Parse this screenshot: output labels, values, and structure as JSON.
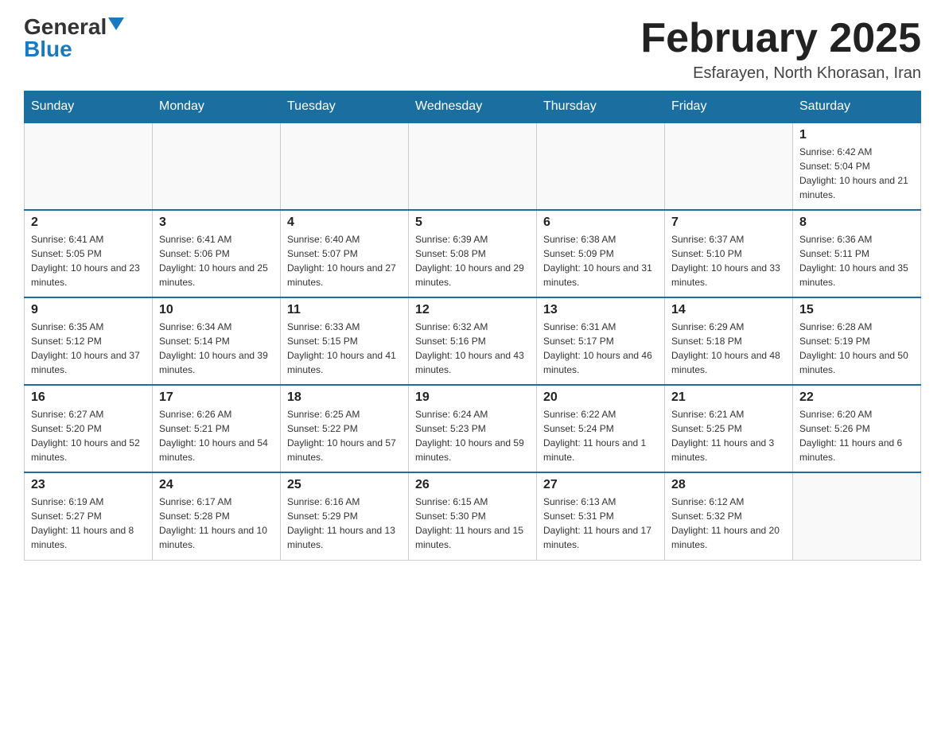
{
  "logo": {
    "general": "General",
    "blue": "Blue"
  },
  "title": "February 2025",
  "location": "Esfarayen, North Khorasan, Iran",
  "days_of_week": [
    "Sunday",
    "Monday",
    "Tuesday",
    "Wednesday",
    "Thursday",
    "Friday",
    "Saturday"
  ],
  "weeks": [
    [
      {
        "day": "",
        "info": ""
      },
      {
        "day": "",
        "info": ""
      },
      {
        "day": "",
        "info": ""
      },
      {
        "day": "",
        "info": ""
      },
      {
        "day": "",
        "info": ""
      },
      {
        "day": "",
        "info": ""
      },
      {
        "day": "1",
        "info": "Sunrise: 6:42 AM\nSunset: 5:04 PM\nDaylight: 10 hours and 21 minutes."
      }
    ],
    [
      {
        "day": "2",
        "info": "Sunrise: 6:41 AM\nSunset: 5:05 PM\nDaylight: 10 hours and 23 minutes."
      },
      {
        "day": "3",
        "info": "Sunrise: 6:41 AM\nSunset: 5:06 PM\nDaylight: 10 hours and 25 minutes."
      },
      {
        "day": "4",
        "info": "Sunrise: 6:40 AM\nSunset: 5:07 PM\nDaylight: 10 hours and 27 minutes."
      },
      {
        "day": "5",
        "info": "Sunrise: 6:39 AM\nSunset: 5:08 PM\nDaylight: 10 hours and 29 minutes."
      },
      {
        "day": "6",
        "info": "Sunrise: 6:38 AM\nSunset: 5:09 PM\nDaylight: 10 hours and 31 minutes."
      },
      {
        "day": "7",
        "info": "Sunrise: 6:37 AM\nSunset: 5:10 PM\nDaylight: 10 hours and 33 minutes."
      },
      {
        "day": "8",
        "info": "Sunrise: 6:36 AM\nSunset: 5:11 PM\nDaylight: 10 hours and 35 minutes."
      }
    ],
    [
      {
        "day": "9",
        "info": "Sunrise: 6:35 AM\nSunset: 5:12 PM\nDaylight: 10 hours and 37 minutes."
      },
      {
        "day": "10",
        "info": "Sunrise: 6:34 AM\nSunset: 5:14 PM\nDaylight: 10 hours and 39 minutes."
      },
      {
        "day": "11",
        "info": "Sunrise: 6:33 AM\nSunset: 5:15 PM\nDaylight: 10 hours and 41 minutes."
      },
      {
        "day": "12",
        "info": "Sunrise: 6:32 AM\nSunset: 5:16 PM\nDaylight: 10 hours and 43 minutes."
      },
      {
        "day": "13",
        "info": "Sunrise: 6:31 AM\nSunset: 5:17 PM\nDaylight: 10 hours and 46 minutes."
      },
      {
        "day": "14",
        "info": "Sunrise: 6:29 AM\nSunset: 5:18 PM\nDaylight: 10 hours and 48 minutes."
      },
      {
        "day": "15",
        "info": "Sunrise: 6:28 AM\nSunset: 5:19 PM\nDaylight: 10 hours and 50 minutes."
      }
    ],
    [
      {
        "day": "16",
        "info": "Sunrise: 6:27 AM\nSunset: 5:20 PM\nDaylight: 10 hours and 52 minutes."
      },
      {
        "day": "17",
        "info": "Sunrise: 6:26 AM\nSunset: 5:21 PM\nDaylight: 10 hours and 54 minutes."
      },
      {
        "day": "18",
        "info": "Sunrise: 6:25 AM\nSunset: 5:22 PM\nDaylight: 10 hours and 57 minutes."
      },
      {
        "day": "19",
        "info": "Sunrise: 6:24 AM\nSunset: 5:23 PM\nDaylight: 10 hours and 59 minutes."
      },
      {
        "day": "20",
        "info": "Sunrise: 6:22 AM\nSunset: 5:24 PM\nDaylight: 11 hours and 1 minute."
      },
      {
        "day": "21",
        "info": "Sunrise: 6:21 AM\nSunset: 5:25 PM\nDaylight: 11 hours and 3 minutes."
      },
      {
        "day": "22",
        "info": "Sunrise: 6:20 AM\nSunset: 5:26 PM\nDaylight: 11 hours and 6 minutes."
      }
    ],
    [
      {
        "day": "23",
        "info": "Sunrise: 6:19 AM\nSunset: 5:27 PM\nDaylight: 11 hours and 8 minutes."
      },
      {
        "day": "24",
        "info": "Sunrise: 6:17 AM\nSunset: 5:28 PM\nDaylight: 11 hours and 10 minutes."
      },
      {
        "day": "25",
        "info": "Sunrise: 6:16 AM\nSunset: 5:29 PM\nDaylight: 11 hours and 13 minutes."
      },
      {
        "day": "26",
        "info": "Sunrise: 6:15 AM\nSunset: 5:30 PM\nDaylight: 11 hours and 15 minutes."
      },
      {
        "day": "27",
        "info": "Sunrise: 6:13 AM\nSunset: 5:31 PM\nDaylight: 11 hours and 17 minutes."
      },
      {
        "day": "28",
        "info": "Sunrise: 6:12 AM\nSunset: 5:32 PM\nDaylight: 11 hours and 20 minutes."
      },
      {
        "day": "",
        "info": ""
      }
    ]
  ]
}
